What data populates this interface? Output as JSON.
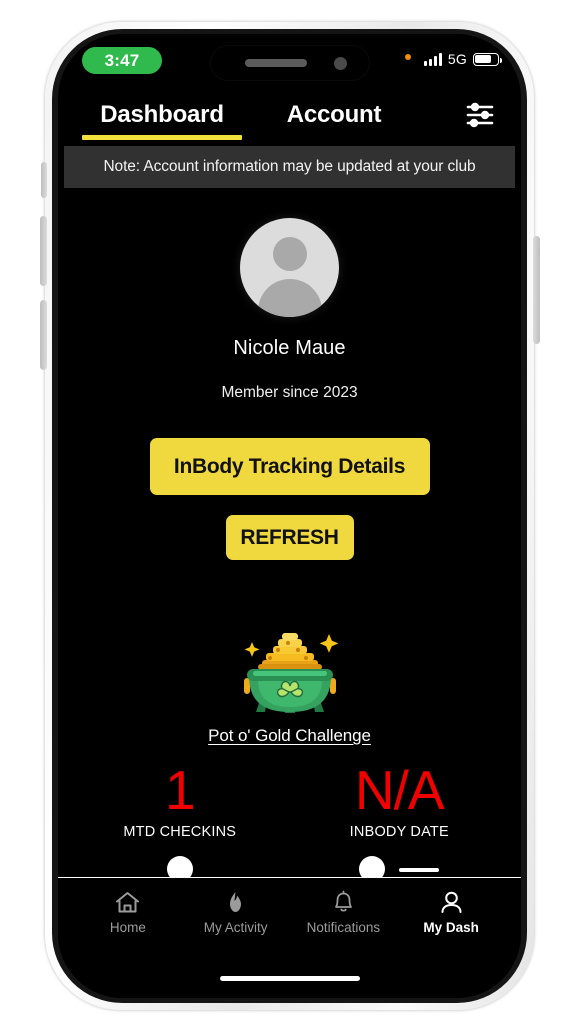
{
  "status_bar": {
    "time": "3:47",
    "network": "5G",
    "battery_percent": 72,
    "recording_indicator": "orange-dot",
    "time_pill_color": "#30b94c"
  },
  "top_tabs": {
    "items": [
      {
        "label": "Dashboard",
        "active": true
      },
      {
        "label": "Account",
        "active": false
      }
    ],
    "active_underline_color": "#f2e03c",
    "settings_icon": "sliders-icon"
  },
  "note_banner": {
    "text": "Note: Account information may be updated at your club",
    "background": "#313131"
  },
  "profile": {
    "avatar_icon": "user-avatar-placeholder",
    "name": "Nicole Maue",
    "member_since": "Member since 2023"
  },
  "actions": {
    "primary_label": "InBody Tracking Details",
    "secondary_label": "REFRESH",
    "button_color": "#f0d93e",
    "button_text_color": "#111111"
  },
  "challenge": {
    "icon": "pot-of-gold-icon",
    "title": "Pot o' Gold Challenge",
    "stats": [
      {
        "value": "1",
        "label": "MTD CHECKINS",
        "value_color": "#f20000"
      },
      {
        "value": "N/A",
        "label": "INBODY DATE",
        "value_color": "#f20000"
      }
    ]
  },
  "bottom_nav": {
    "items": [
      {
        "label": "Home",
        "icon": "home-icon",
        "active": false
      },
      {
        "label": "My Activity",
        "icon": "flame-icon",
        "active": false
      },
      {
        "label": "Notifications",
        "icon": "bell-icon",
        "active": false
      },
      {
        "label": "My Dash",
        "icon": "person-icon",
        "active": true
      }
    ],
    "active_color": "#ffffff",
    "inactive_color": "#9b9b9b"
  }
}
